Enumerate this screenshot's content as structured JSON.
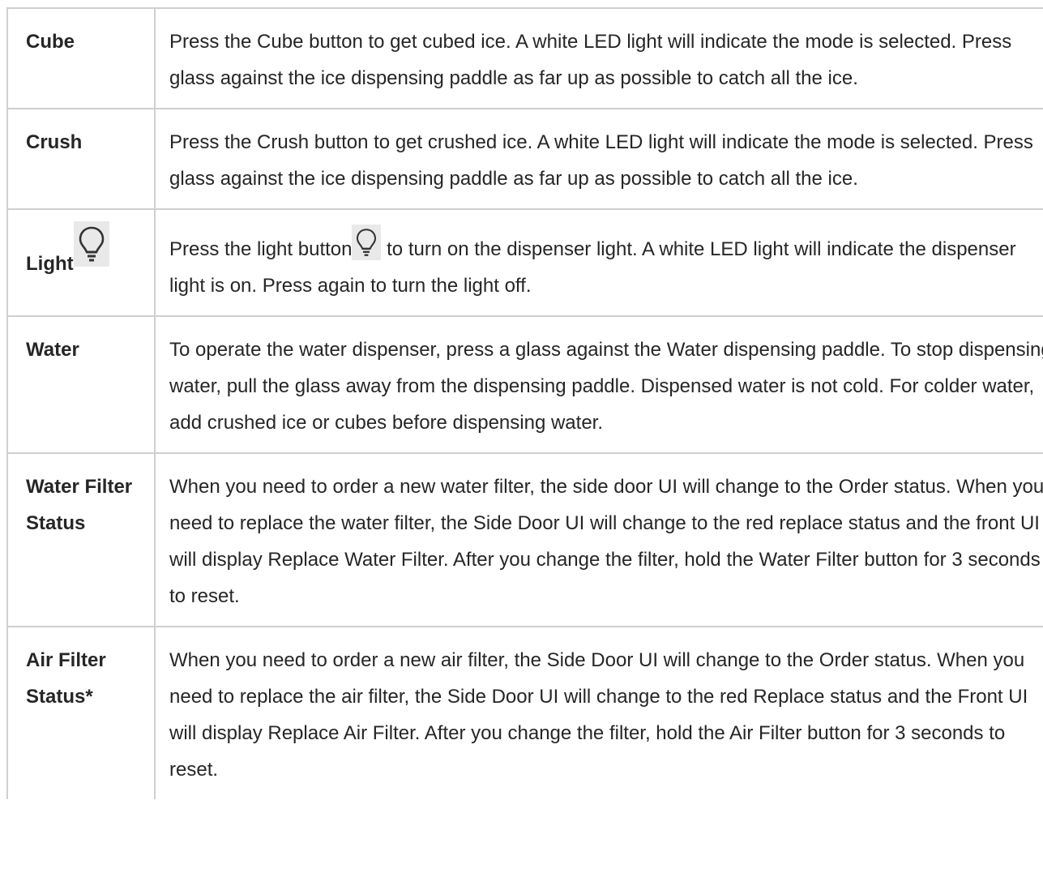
{
  "rows": [
    {
      "term": "Cube",
      "desc": "Press the Cube button to get cubed ice. A white LED light will indicate the mode is selected. Press glass against the ice dispensing paddle as far up as possible to catch all the ice."
    },
    {
      "term": "Crush",
      "desc": "Press the Crush button to get crushed ice. A white LED light will indicate the mode is selected. Press glass against the ice dispensing paddle as far up as possible to catch all the ice."
    },
    {
      "term": "Light",
      "icon": "light-bulb-icon",
      "desc_before": "Press the light button",
      "desc_after": " to turn on the dispenser light. A white LED light will indicate the dispenser light is on. Press again to turn the light off."
    },
    {
      "term": "Water",
      "desc": "To operate the water dispenser, press a glass against the Water dispensing paddle. To stop dispensing water, pull the glass away from the dispensing paddle. Dispensed water is not cold. For colder water, add crushed ice or cubes before dispensing water."
    },
    {
      "term": "Water Filter Status",
      "desc": "When you need to order a new water filter, the side door UI will change to the Order status. When you need to replace the water filter, the Side Door UI will change to the red replace status and the front UI will display Replace Water Filter. After you change the filter, hold the Water Filter button for 3 seconds to reset."
    },
    {
      "term": "Air Filter Status*",
      "desc": "When you need to order a new air filter, the Side Door UI will change to the Order status. When you need to replace the air filter, the Side Door UI will change to the red Replace status and the Front UI will display Replace Air Filter. After you change the filter, hold the Air Filter button for 3 seconds to reset."
    }
  ]
}
